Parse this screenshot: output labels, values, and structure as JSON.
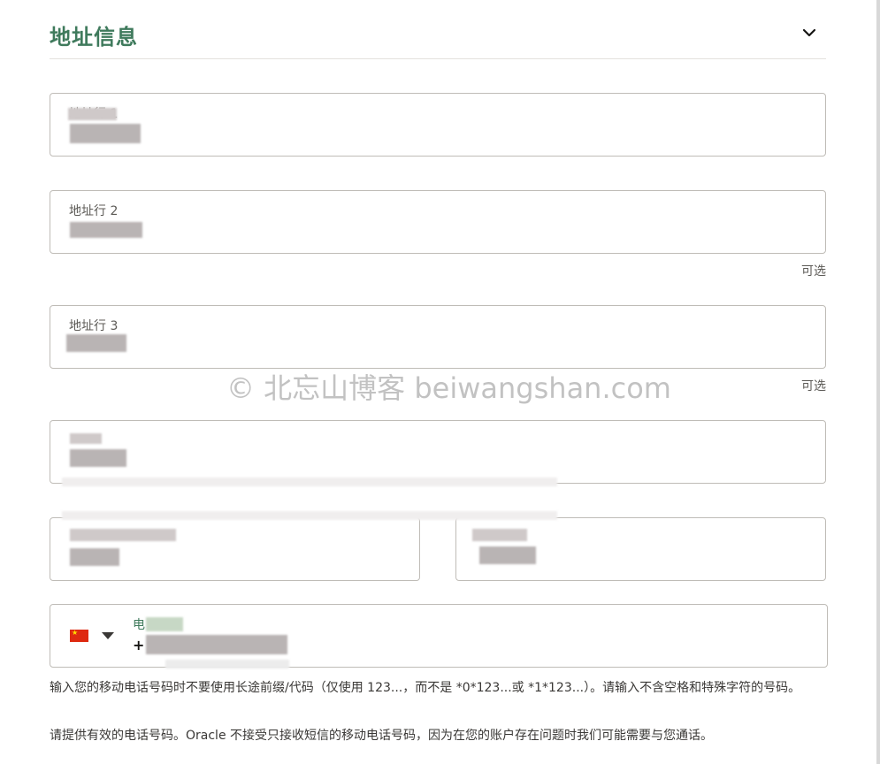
{
  "section": {
    "title": "地址信息",
    "collapse_icon": "chevron-down-icon"
  },
  "fields": {
    "address1": {
      "label": "地址行 1",
      "value": ""
    },
    "address2": {
      "label": "地址行 2",
      "value": "",
      "optional": "可选"
    },
    "address3": {
      "label": "地址行 3",
      "value": "",
      "optional": "可选"
    },
    "city": {
      "label": "",
      "value": ""
    },
    "state": {
      "label": "",
      "value": ""
    },
    "postal": {
      "label": "",
      "value": ""
    },
    "phone": {
      "label": "电",
      "prefix": "+",
      "country_flag": "china-flag-icon"
    }
  },
  "watermark": "© 北忘山博客 beiwangshan.com",
  "help": {
    "line1": "输入您的移动电话号码时不要使用长途前缀/代码（仅使用 123...，而不是 *0*123...或 *1*123...）。请输入不含空格和特殊字符的号码。",
    "line2": "请提供有效的电话号码。Oracle 不接受只接收短信的移动电话号码，因为在您的账户存在问题时我们可能需要与您通话。"
  }
}
